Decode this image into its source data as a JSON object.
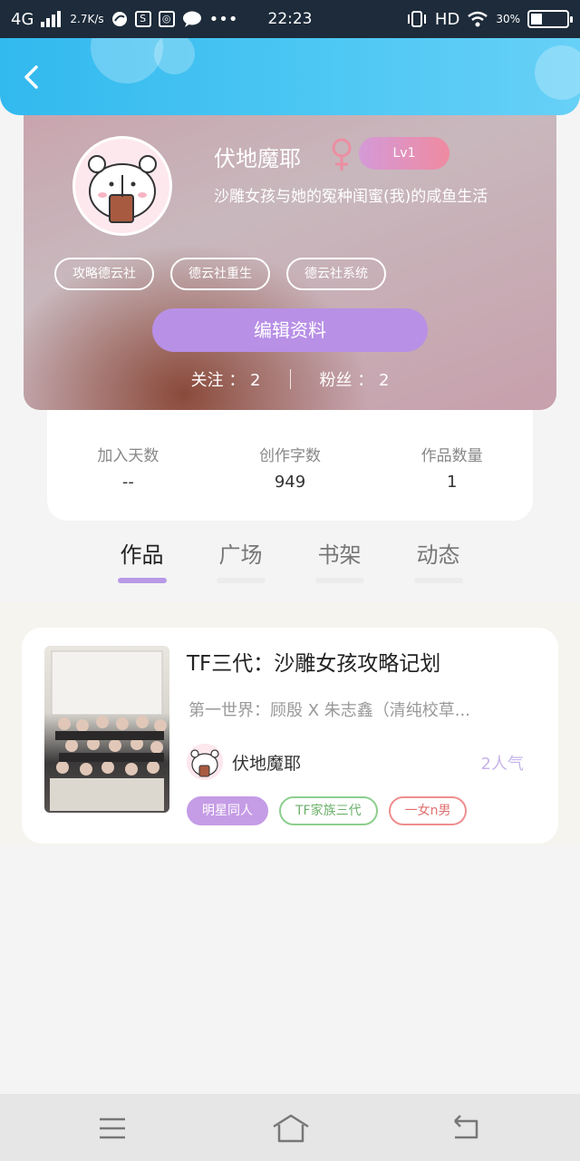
{
  "status_bar": {
    "network": "4G",
    "speed": "2.7K/s",
    "time": "22:23",
    "hd": "HD",
    "battery": "30%"
  },
  "profile": {
    "username": "伏地魔耶",
    "level": "Lv1",
    "bio": "沙雕女孩与她的冤种闺蜜(我)的咸鱼生活",
    "tags": [
      "攻略德云社",
      "德云社重生",
      "德云社系统"
    ],
    "edit_button": "编辑资料",
    "following_label": "关注",
    "following_count": "2",
    "followers_label": "粉丝",
    "followers_count": "2"
  },
  "stats": [
    {
      "label": "加入天数",
      "value": "--"
    },
    {
      "label": "创作字数",
      "value": "949"
    },
    {
      "label": "作品数量",
      "value": "1"
    }
  ],
  "tabs": [
    {
      "label": "作品",
      "active": true
    },
    {
      "label": "广场",
      "active": false
    },
    {
      "label": "书架",
      "active": false
    },
    {
      "label": "动态",
      "active": false
    }
  ],
  "works": [
    {
      "title": "TF三代：沙雕女孩攻略记划",
      "description": "第一世界：顾殷 X 朱志鑫（清纯校草...",
      "author": "伏地魔耶",
      "popularity": "2人气",
      "tags": [
        "明星同人",
        "TF家族三代",
        "一女n男"
      ]
    }
  ],
  "colors": {
    "header": "#32b9ee",
    "accent_purple": "#b890e6",
    "level_badge": "#ef8aa0",
    "tab_underline": "#b89ae6"
  }
}
